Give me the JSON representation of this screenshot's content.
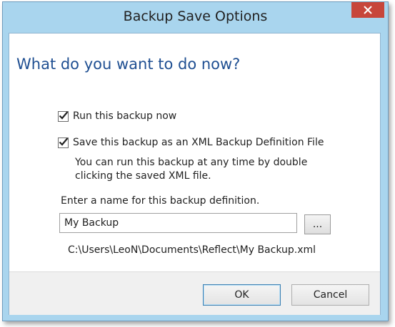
{
  "window": {
    "title": "Backup Save Options",
    "close_icon": "close-icon"
  },
  "content": {
    "heading": "What do you want to do now?",
    "run_now": {
      "label": "Run this backup now",
      "checked": true
    },
    "save_xml": {
      "label": "Save this backup as an XML Backup Definition File",
      "checked": true
    },
    "note": "You can run this backup at any time by double clicking the saved XML file.",
    "name_label": "Enter a name for this backup definition.",
    "name_value": "My Backup",
    "browse_label": "...",
    "path": "C:\\Users\\LeoN\\Documents\\Reflect\\My Backup.xml"
  },
  "footer": {
    "ok_label": "OK",
    "cancel_label": "Cancel"
  },
  "colors": {
    "heading": "#1f4f92",
    "close_button": "#c7463b",
    "frame": "#a9d5ee"
  }
}
